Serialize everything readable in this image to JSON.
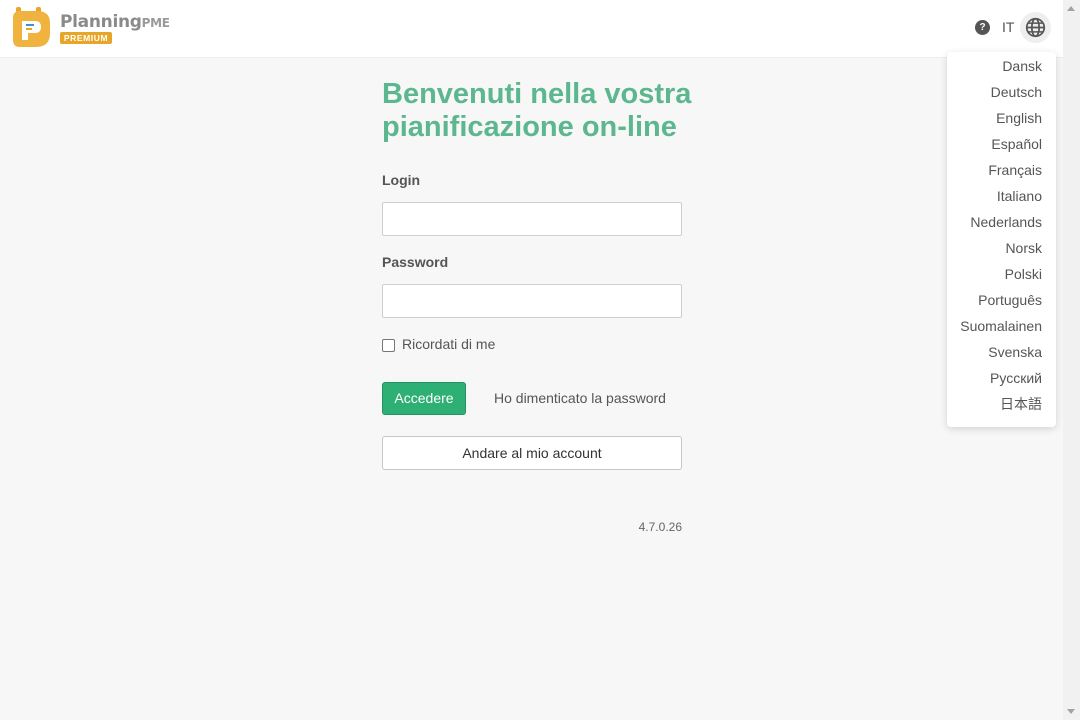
{
  "header": {
    "logo_word": "Planning",
    "logo_suffix": "PME",
    "logo_badge": "PREMIUM",
    "help_icon": "question-circle-icon",
    "language_code": "IT",
    "globe_icon": "globe-icon"
  },
  "language_menu": {
    "items": [
      "Dansk",
      "Deutsch",
      "English",
      "Español",
      "Français",
      "Italiano",
      "Nederlands",
      "Norsk",
      "Polski",
      "Português",
      "Suomalainen",
      "Svenska",
      "Русский",
      "日本語"
    ]
  },
  "login_form": {
    "title_line1": "Benvenuti nella vostra",
    "title_line2": "pianificazione on-line",
    "login_label": "Login",
    "login_value": "",
    "password_label": "Password",
    "password_value": "",
    "remember_label": "Ricordati di me",
    "remember_checked": false,
    "submit_label": "Accedere",
    "forgot_label": "Ho dimenticato la password",
    "account_label": "Andare al mio account",
    "version": "4.7.0.26"
  },
  "colors": {
    "title": "#5cb78e",
    "primary_button": "#2eaf74",
    "badge": "#e8a628"
  }
}
